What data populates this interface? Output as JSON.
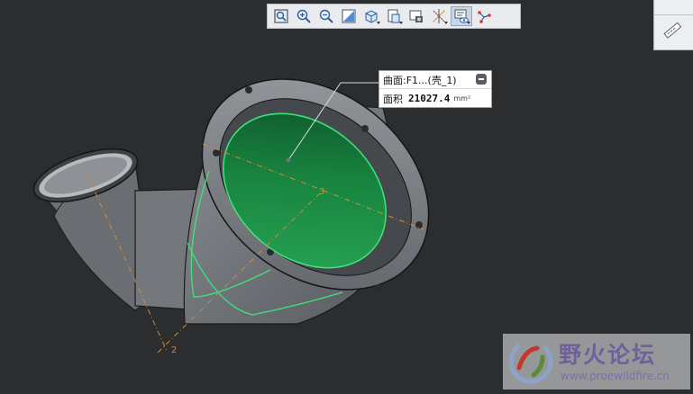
{
  "toolbar": {
    "buttons": [
      {
        "icon": "zoom-fit-icon"
      },
      {
        "icon": "zoom-in-icon"
      },
      {
        "icon": "zoom-out-icon"
      },
      {
        "icon": "repaint-icon"
      },
      {
        "icon": "view-orientation-icon"
      },
      {
        "icon": "saved-views-icon"
      },
      {
        "icon": "view-manager-icon"
      },
      {
        "icon": "datum-display-icon"
      },
      {
        "icon": "annotation-display-icon"
      },
      {
        "icon": "spin-center-icon"
      }
    ]
  },
  "callout": {
    "title": "曲面:F1...(壳_1)",
    "label": "面积",
    "value": "21027.4",
    "unit": "mm²"
  },
  "model": {
    "axis_label_3": "3",
    "axis_label_2": "2",
    "colors": {
      "body": "#6f7378",
      "surface": "#1e9a4a",
      "edge_highlight": "#3fe07a",
      "axis": "#d08a3c"
    }
  },
  "watermark": {
    "title": "野火论坛",
    "url": "www.proewildfire.cn"
  }
}
